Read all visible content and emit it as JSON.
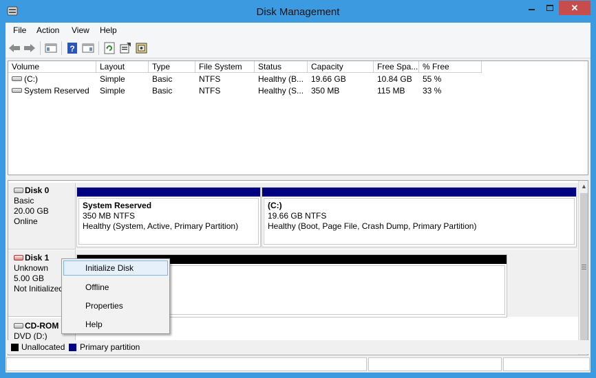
{
  "window": {
    "title": "Disk Management",
    "app_icon": "disk-management-icon",
    "controls": {
      "minimize_icon": "minimize-icon",
      "maximize_icon": "maximize-icon",
      "close_icon": "close-icon",
      "close_glyph": "✕"
    },
    "titlebar_color": "#3c9be0",
    "close_color": "#c74d4d"
  },
  "menubar": {
    "items": [
      "File",
      "Action",
      "View",
      "Help"
    ]
  },
  "toolbar": {
    "buttons": [
      "back-icon",
      "forward-icon",
      "show-hide-console-tree-icon",
      "help-icon",
      "show-hide-action-pane-icon",
      "refresh-icon",
      "properties-icon",
      "rescan-disks-icon"
    ]
  },
  "volumes": {
    "columns": [
      "Volume",
      "Layout",
      "Type",
      "File System",
      "Status",
      "Capacity",
      "Free Spa...",
      "% Free"
    ],
    "rows": [
      {
        "volume": "(C:)",
        "layout": "Simple",
        "type": "Basic",
        "fs": "NTFS",
        "status": "Healthy (B...",
        "capacity": "19.66 GB",
        "free": "10.84 GB",
        "pct": "55 %"
      },
      {
        "volume": "System Reserved",
        "layout": "Simple",
        "type": "Basic",
        "fs": "NTFS",
        "status": "Healthy (S...",
        "capacity": "350 MB",
        "free": "115 MB",
        "pct": "33 %"
      }
    ]
  },
  "disks": {
    "disk0": {
      "name": "Disk 0",
      "type": "Basic",
      "size": "20.00 GB",
      "state": "Online",
      "partitions": [
        {
          "name": "System Reserved",
          "size": "350 MB NTFS",
          "status": "Healthy (System, Active, Primary Partition)"
        },
        {
          "name": "(C:)",
          "size": "19.66 GB NTFS",
          "status": "Healthy (Boot, Page File, Crash Dump, Primary Partition)"
        }
      ]
    },
    "disk1": {
      "name": "Disk 1",
      "type": "Unknown",
      "size": "5.00 GB",
      "state": "Not Initialized"
    },
    "cdrom": {
      "name": "CD-ROM",
      "type": "DVD (D:)"
    }
  },
  "legend": {
    "items": [
      {
        "label": "Unallocated",
        "color": "#000000"
      },
      {
        "label": "Primary partition",
        "color": "#000080"
      }
    ]
  },
  "context_menu": {
    "items": [
      "Initialize Disk",
      "Offline",
      "Properties",
      "Help"
    ],
    "highlighted": "Initialize Disk"
  },
  "colors": {
    "primary_partition": "#000080",
    "unallocated": "#000000"
  }
}
